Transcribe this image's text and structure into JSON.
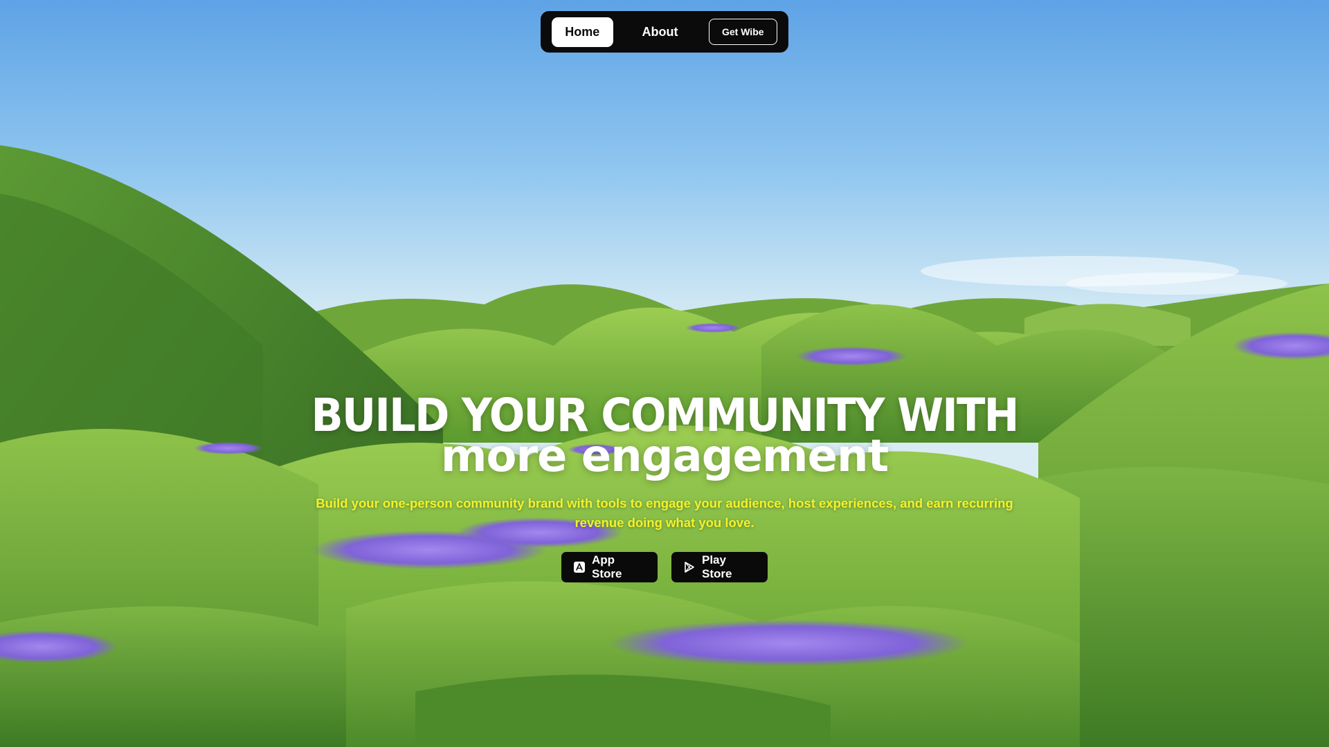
{
  "nav": {
    "home_label": "Home",
    "about_label": "About",
    "cta_label": "Get Wibe"
  },
  "hero": {
    "headline_line1": "BUILD YOUR COMMUNITY WITH",
    "headline_line2": "more engagement",
    "subtitle": "Build your one-person community brand with tools to engage your audience, host experiences, and earn recurring revenue doing what you love."
  },
  "stores": {
    "app_store_label": "App Store",
    "app_store_icon": "app-store-icon",
    "play_store_label": "Play Store",
    "play_store_icon": "play-store-icon"
  },
  "colors": {
    "subtitle": "#f3f12a",
    "nav_bg": "#0b0b0b",
    "grass": "#5fa12c",
    "flowers": "#8a6fe0"
  }
}
